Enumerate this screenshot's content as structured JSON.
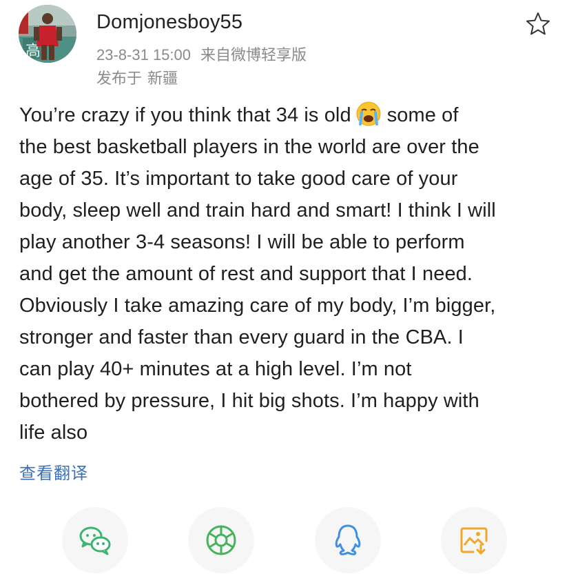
{
  "post": {
    "username": "Domjonesboy55",
    "timestamp": "23-8-31 15:00",
    "source": "来自微博轻享版",
    "location_prefix": "发布于",
    "location": "新疆",
    "avatar_text": "高",
    "text_lines": [
      "You’re crazy if you think that 34 is old",
      "some of",
      "the best basketball players in the world are over the",
      "age of 35. It’s important to take good care of your",
      "body, sleep well and train hard and smart! I think I will",
      "play another 3-4 seasons! I will be able to perform",
      "and get the amount of rest and support that I need.",
      "Obviously I take amazing care of my body, I’m bigger,",
      "stronger and faster than every guard in the CBA. I",
      "can play 40+ minutes at a high level. I’m not",
      "bothered by pressure, I hit big shots. I’m happy with",
      "life also"
    ],
    "emoji": "loudly-crying-face",
    "translate_label": "查看翻译"
  },
  "icons": {
    "favorite": "star-outline-icon",
    "share": [
      "wechat-icon",
      "moments-icon",
      "qq-icon",
      "save-image-icon"
    ]
  },
  "colors": {
    "wechat": "#3cb371",
    "moments": "#46b35a",
    "qq": "#3f8fe0",
    "save_image": "#f0a629",
    "link": "#3b6fb6",
    "meta_gray": "#8a8a8a"
  }
}
